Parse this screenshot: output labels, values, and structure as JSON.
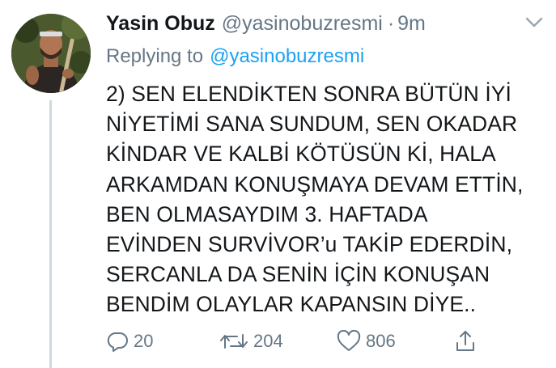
{
  "tweet": {
    "display_name": "Yasin Obuz",
    "handle": "@yasinobuzresmi",
    "separator": "·",
    "time": "9m",
    "replying_label": "Replying to",
    "replying_handle": "@yasinobuzresmi",
    "body_lines": [
      "2) SEN ELENDİKTEN SONRA BÜTÜN İYİ",
      "NİYETİMİ SANA SUNDUM, SEN OKADAR",
      "KİNDAR VE KALBİ KÖTÜSÜN Kİ, HALA",
      "ARKAMDAN KONUŞMAYA DEVAM ETTİN,",
      "BEN OLMASAYDIM 3. HAFTADA",
      "EVİNDEN SURVİVOR’u TAKİP EDERDİN,",
      "SERCANLA DA SENİN İÇİN KONUŞAN",
      "BENDİM OLAYLAR KAPANSIN DİYE.."
    ],
    "actions": {
      "reply_count": "20",
      "retweet_count": "204",
      "like_count": "806"
    }
  },
  "icons": {
    "avatar": "profile-photo",
    "menu": "chevron-down-icon",
    "reply": "reply-icon",
    "retweet": "retweet-icon",
    "like": "heart-icon",
    "share": "share-icon"
  },
  "colors": {
    "text": "#14171a",
    "secondary": "#657786",
    "link": "#1da1f2",
    "thread_line": "#cfd9de"
  }
}
